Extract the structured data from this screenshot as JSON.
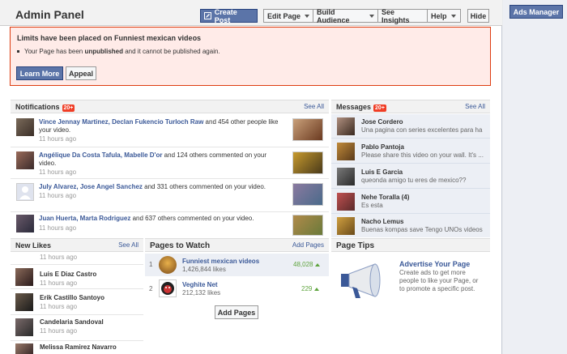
{
  "header": {
    "title": "Admin Panel",
    "create_post": "Create Post",
    "edit_page": "Edit Page",
    "build_audience": "Build Audience",
    "see_insights": "See Insights",
    "help": "Help",
    "hide": "Hide"
  },
  "right": {
    "ads_manager": "Ads Manager"
  },
  "alert": {
    "title": "Limits have been placed on Funniest mexican videos",
    "body_pre": "Your Page has been ",
    "body_bold": "unpublished",
    "body_post": " and it cannot be published again.",
    "learn_more": "Learn More",
    "appeal": "Appeal"
  },
  "notifications": {
    "title": "Notifications",
    "badge": "20+",
    "see_all": "See All",
    "items": [
      {
        "names": "Vince Jennay Martinez, Declan Fukencio Turloch Raw",
        "rest": " and 454 other people like your video.",
        "time": "11 hours ago"
      },
      {
        "names": "Angélique Da Costa Tafula, Mabelle D'or",
        "rest": " and 124 others commented on your video.",
        "time": "11 hours ago"
      },
      {
        "names": "July Alvarez, Jose Angel Sanchez",
        "rest": " and 331 others commented on your video.",
        "time": "11 hours ago"
      },
      {
        "names": "Juan Huerta, Marta Rodriguez",
        "rest": " and 637 others commented on your video.",
        "time": "11 hours ago"
      }
    ]
  },
  "messages": {
    "title": "Messages",
    "badge": "20+",
    "see_all": "See All",
    "items": [
      {
        "name": "Jose Cordero",
        "preview": "Una pagina con series excelentes para ha"
      },
      {
        "name": "Pablo Pantoja",
        "preview": "Please share this video on your wall. It's ..."
      },
      {
        "name": "Luis E Garcia",
        "preview": "queonda amigo tu eres de mexico??"
      },
      {
        "name": "Nehe Toralla (4)",
        "preview": "Es esta"
      },
      {
        "name": "Nacho Lemus",
        "preview": "Buenas kompas save Tengo UNOs videos ..."
      }
    ]
  },
  "new_likes": {
    "title": "New Likes",
    "see_all": "See All",
    "first_time": "11 hours ago",
    "items": [
      {
        "name": "Luis E Diaz Castro",
        "time": "11 hours ago"
      },
      {
        "name": "Erik Castillo Santoyo",
        "time": "11 hours ago"
      },
      {
        "name": "Candelaria Sandoval",
        "time": "11 hours ago"
      },
      {
        "name": "Melissa Ramirez Navarro",
        "time": ""
      }
    ]
  },
  "pages_to_watch": {
    "title": "Pages to Watch",
    "add_link": "Add Pages",
    "add_button": "Add Pages",
    "items": [
      {
        "num": "1",
        "name": "Funniest mexican videos",
        "likes": "1,426,844 likes",
        "count": "48,028"
      },
      {
        "num": "2",
        "name": "Veghite Net",
        "likes": "212,132 likes",
        "count": "229"
      }
    ]
  },
  "page_tips": {
    "title": "Page Tips",
    "heading": "Advertise Your Page",
    "body": "Create ads to get more people to like your Page, or to promote a specific post."
  }
}
